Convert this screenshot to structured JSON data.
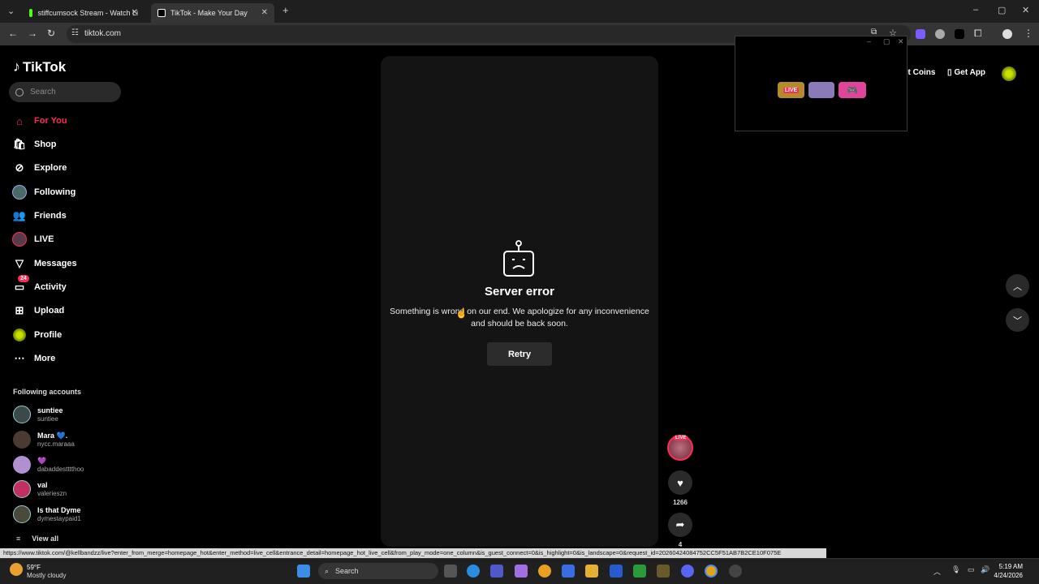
{
  "browser": {
    "tabs": [
      {
        "label": "stiffcumsock Stream - Watch Li"
      },
      {
        "label": "TikTok - Make Your Day"
      }
    ],
    "url": "tiktok.com"
  },
  "sidebar": {
    "logo": "TikTok",
    "search_placeholder": "Search",
    "nav": [
      {
        "label": "For You"
      },
      {
        "label": "Shop"
      },
      {
        "label": "Explore"
      },
      {
        "label": "Following"
      },
      {
        "label": "Friends"
      },
      {
        "label": "LIVE"
      },
      {
        "label": "Messages"
      },
      {
        "label": "Activity",
        "badge": "24"
      },
      {
        "label": "Upload"
      },
      {
        "label": "Profile"
      },
      {
        "label": "More"
      }
    ],
    "following_heading": "Following accounts",
    "accounts": [
      {
        "name": "suntiee",
        "username": "suntiee"
      },
      {
        "name": "Mara 💙.",
        "username": "nycc.maraaa"
      },
      {
        "name": "💜",
        "username": "dabaddestttthoo"
      },
      {
        "name": "val",
        "username": "valerieszn"
      },
      {
        "name": "Is that Dyme",
        "username": "dymestaypaid1"
      }
    ],
    "view_all": "View all"
  },
  "header": {
    "coins": "et Coins",
    "get_app": "Get App"
  },
  "error": {
    "title": "Server error",
    "message": "Something is wrong on our end. We apologize for any inconvenience and should be back soon.",
    "retry": "Retry"
  },
  "actions": {
    "live_badge": "LIVE",
    "likes": "1266",
    "shares": "4"
  },
  "status_url": "https://www.tiktok.com/@kellbandzz/live?enter_from_merge=homepage_hot&enter_method=live_cell&entrance_detail=homepage_hot_live_cell&from_play_mode=one_column&is_guest_connect=0&is_highlight=0&is_landscape=0&request_id=20260424084752CC5F51AB7B2CE10F075E",
  "popup": {
    "live_label": "LIVE"
  },
  "taskbar": {
    "temperature": "59°F",
    "weather": "Mostly cloudy",
    "search": "Search",
    "time": "5:19 AM",
    "date": "4/24/2026"
  },
  "colors": {
    "accent": "#fe2c55",
    "background": "#000000",
    "card": "#141414"
  }
}
